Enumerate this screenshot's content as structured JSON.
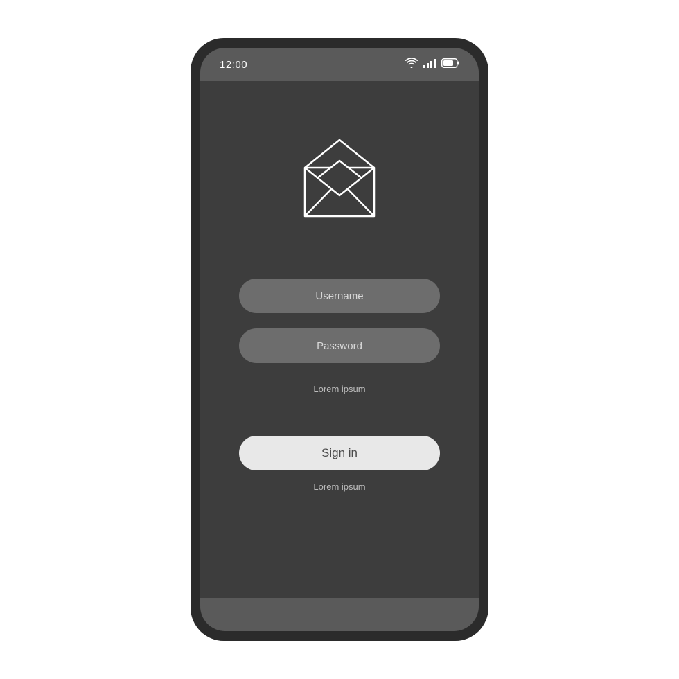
{
  "status_bar": {
    "time": "12:00"
  },
  "form": {
    "username_placeholder": "Username",
    "password_placeholder": "Password",
    "helper_text_1": "Lorem ipsum",
    "signin_label": "Sign in",
    "helper_text_2": "Lorem ipsum"
  },
  "colors": {
    "phone_frame": "#2b2b2b",
    "screen_bg": "#3d3d3d",
    "bar_bg": "#5a5a5a",
    "input_bg": "#6d6d6d",
    "button_bg": "#e8e8e8"
  }
}
